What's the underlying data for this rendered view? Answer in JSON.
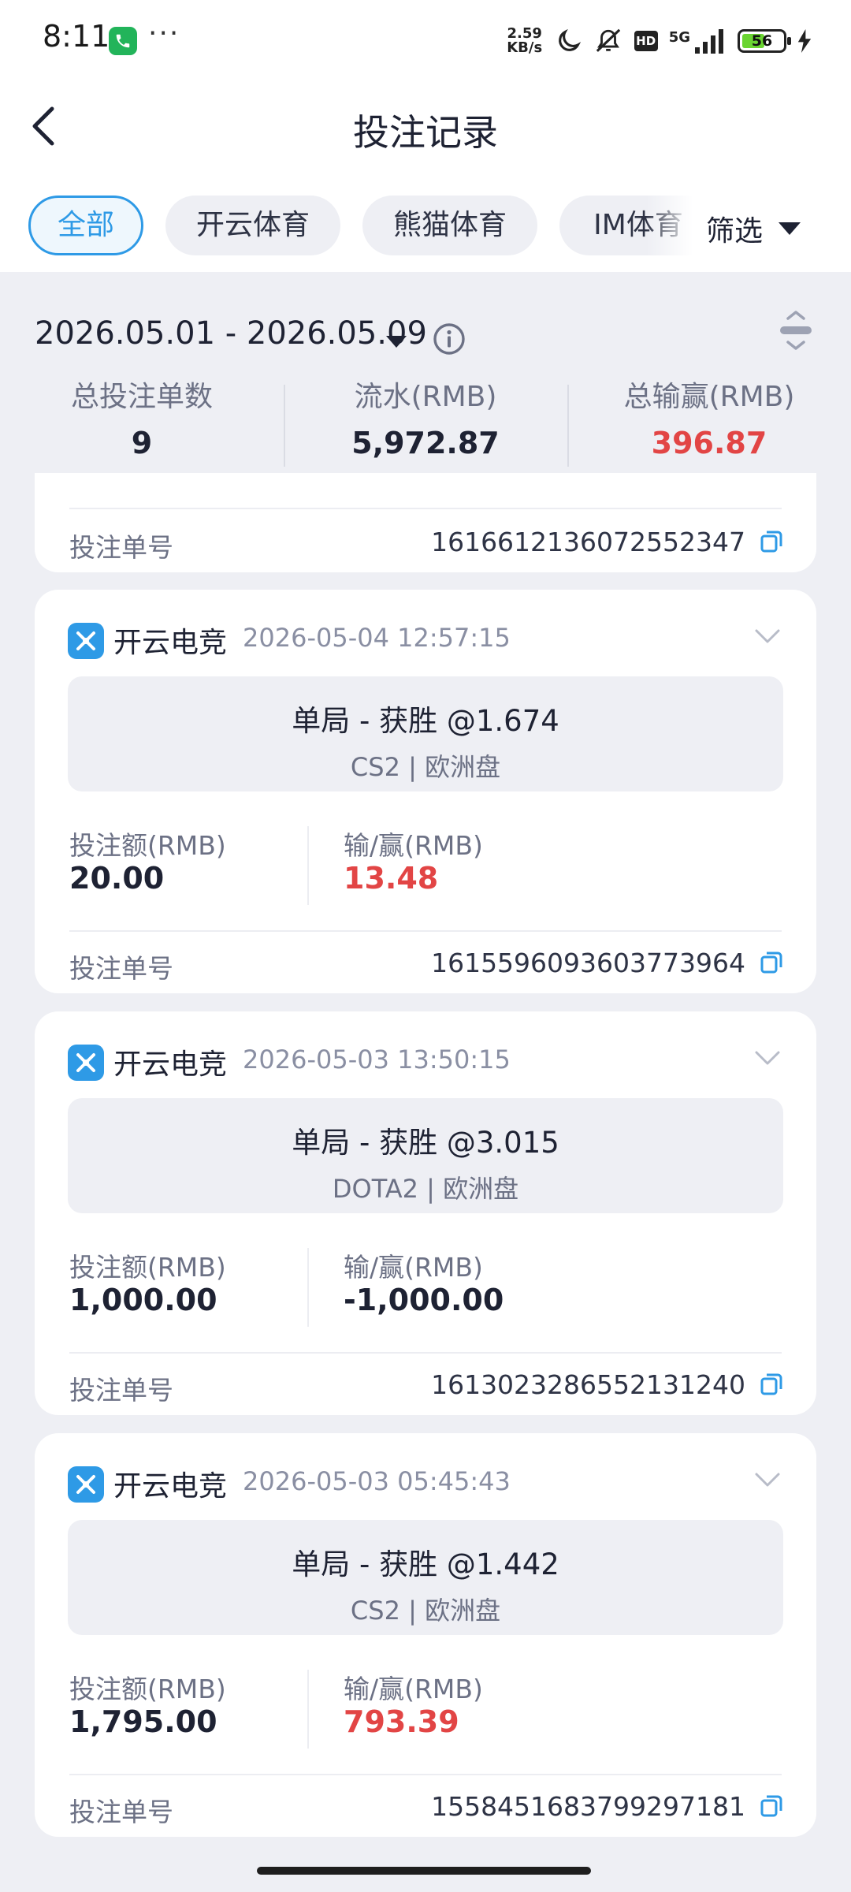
{
  "status_bar": {
    "time": "8:11",
    "dots": "···",
    "speed_value": "2.59",
    "speed_unit": "KB/s",
    "hd": "HD",
    "network": "5G",
    "battery": "56",
    "battery_level": 0.56
  },
  "header": {
    "title": "投注记录",
    "back_icon": "chevron-left-icon"
  },
  "tabs": [
    {
      "label": "全部",
      "active": true
    },
    {
      "label": "开云体育",
      "active": false
    },
    {
      "label": "熊猫体育",
      "active": false
    },
    {
      "label": "IM体育",
      "active": false
    }
  ],
  "filter": {
    "label": "筛选"
  },
  "summary": {
    "date_range": "2026.05.01 - 2026.05.09",
    "stats": [
      {
        "label": "总投注单数",
        "value": "9"
      },
      {
        "label": "流水(RMB)",
        "value": "5,972.87"
      },
      {
        "label": "总输赢(RMB)",
        "value": "396.87"
      }
    ]
  },
  "partial_card": {
    "order_label": "投注单号",
    "order_id": "1616612136072552347"
  },
  "records": [
    {
      "brand": "开云电竞",
      "time": "2026-05-04 12:57:15",
      "bet_title": "单局 - 获胜 @1.674",
      "bet_sub": "CS2 | 欧洲盘",
      "stake_label": "投注额(RMB)",
      "stake": "20.00",
      "pl_label": "输/赢(RMB)",
      "pl": "13.48",
      "order_label": "投注单号",
      "order_id": "1615596093603773964"
    },
    {
      "brand": "开云电竞",
      "time": "2026-05-03 13:50:15",
      "bet_title": "单局 - 获胜 @3.015",
      "bet_sub": "DOTA2 | 欧洲盘",
      "stake_label": "投注额(RMB)",
      "stake": "1,000.00",
      "pl_label": "输/赢(RMB)",
      "pl": "-1,000.00",
      "order_label": "投注单号",
      "order_id": "1613023286552131240"
    },
    {
      "brand": "开云电竞",
      "time": "2026-05-03 05:45:43",
      "bet_title": "单局 - 获胜 @1.442",
      "bet_sub": "CS2 | 欧洲盘",
      "stake_label": "投注额(RMB)",
      "stake": "1,795.00",
      "pl_label": "输/赢(RMB)",
      "pl": "793.39",
      "order_label": "投注单号",
      "order_id": "1558451683799297181"
    }
  ],
  "colors": {
    "accent": "#2E9AE6",
    "profit": "#E24545",
    "background": "#EEEFF4"
  }
}
